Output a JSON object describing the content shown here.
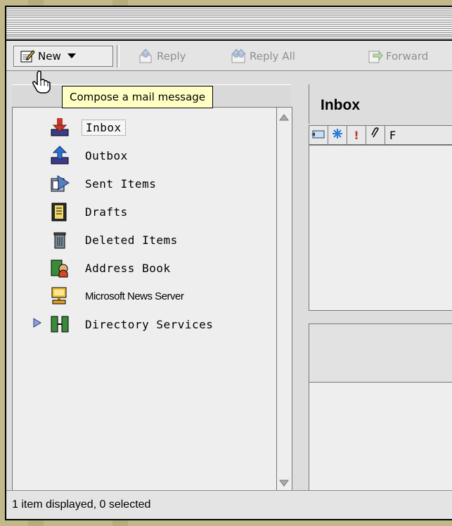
{
  "toolbar": {
    "new_label": "New",
    "reply_label": "Reply",
    "reply_all_label": "Reply All",
    "forward_label": "Forward"
  },
  "tooltip": "Compose a mail message",
  "sidebar": {
    "items": [
      {
        "label": "Inbox",
        "icon": "inbox-icon"
      },
      {
        "label": "Outbox",
        "icon": "outbox-icon"
      },
      {
        "label": "Sent Items",
        "icon": "sent-items-icon"
      },
      {
        "label": "Drafts",
        "icon": "drafts-icon"
      },
      {
        "label": "Deleted Items",
        "icon": "trash-icon"
      },
      {
        "label": "Address Book",
        "icon": "address-book-icon"
      },
      {
        "label": "Microsoft News Server",
        "icon": "news-server-icon"
      },
      {
        "label": "Directory Services",
        "icon": "directory-services-icon"
      }
    ]
  },
  "main": {
    "title": "Inbox",
    "column_headers": [
      "",
      "",
      "!",
      "",
      "F"
    ]
  },
  "status": "1 item displayed, 0 selected",
  "colors": {
    "desktop": "#c2b98a",
    "window": "#dddddd",
    "tooltip": "#ffffc4"
  }
}
